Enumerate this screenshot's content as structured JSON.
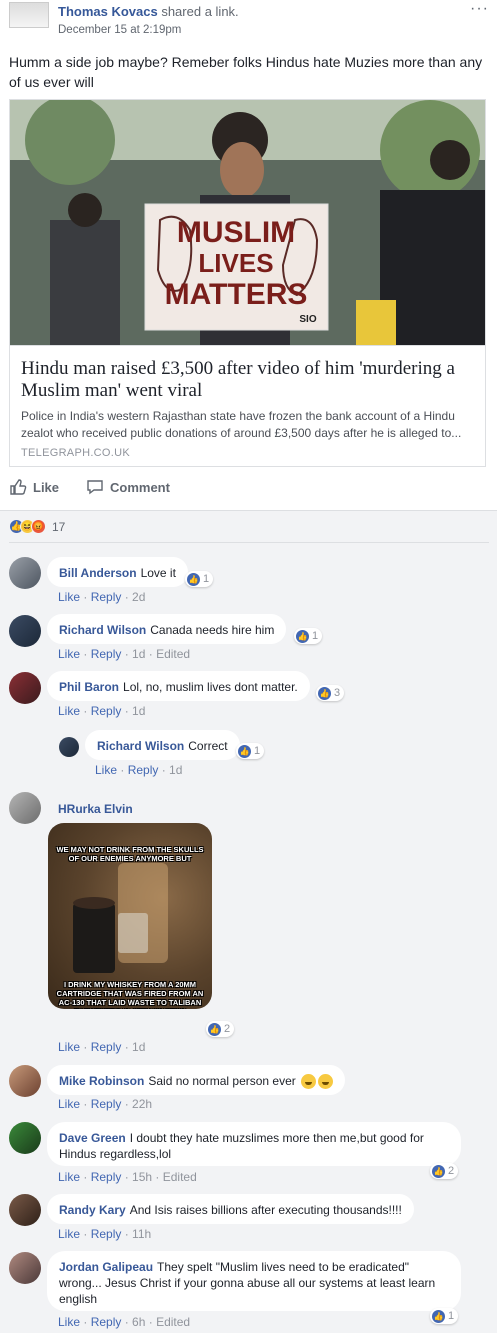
{
  "post": {
    "author": "Thomas Kovacs",
    "action": "shared a",
    "action_link": "link.",
    "timestamp": "December 15 at 2:19pm",
    "more_icon": "ellipsis-icon",
    "text": "Humm a side job maybe? Remeber folks Hindus hate Muzies more than any of us ever will",
    "link": {
      "image_sign_text": [
        "MUSLIM",
        "LIVES",
        "MATTERS",
        "SIO"
      ],
      "title": "Hindu man raised £3,500 after video of him 'murdering a Muslim man' went viral",
      "description": "Police in India's western Rajasthan state have frozen the bank account of a Hindu zealot who received public donations of around £3,500 days after he is alleged to...",
      "domain": "TELEGRAPH.CO.UK"
    },
    "actions": {
      "like": "Like",
      "comment": "Comment"
    },
    "reactions": {
      "count": "17",
      "types": [
        "like-icon",
        "haha-icon",
        "angry-icon"
      ]
    }
  },
  "comments": [
    {
      "name": "Bill Anderson",
      "text": "Love it",
      "like": "Like",
      "reply": "Reply",
      "time": "2d",
      "reacts": "1",
      "edited": ""
    },
    {
      "name": "Richard Wilson",
      "text": "Canada needs hire him",
      "like": "Like",
      "reply": "Reply",
      "time": "1d",
      "reacts": "1",
      "edited": "Edited"
    },
    {
      "name": "Phil Baron",
      "text": "Lol, no, muslim lives dont matter.",
      "like": "Like",
      "reply": "Reply",
      "time": "1d",
      "reacts": "3",
      "edited": ""
    },
    {
      "name": "Richard Wilson",
      "text": "Correct",
      "like": "Like",
      "reply": "Reply",
      "time": "1d",
      "reacts": "1",
      "edited": ""
    },
    {
      "name": "HRurka Elvin",
      "text": "",
      "like": "Like",
      "reply": "Reply",
      "time": "1d",
      "reacts": "2",
      "edited": "",
      "meme_top": "WE MAY NOT DRINK FROM THE SKULLS OF OUR ENEMIES ANYMORE BUT",
      "meme_bottom": "I DRINK MY WHISKEY FROM A 20MM CARTRIDGE THAT WAS FIRED FROM AN AC-130 THAT LAID WASTE TO TALIBAN FUCKTARDS IN AFGHANISTAN"
    },
    {
      "name": "Mike Robinson",
      "text": "Said no normal person ever",
      "like": "Like",
      "reply": "Reply",
      "time": "22h",
      "reacts": "",
      "edited": ""
    },
    {
      "name": "Dave Green",
      "text": "I doubt they hate muzslimes more then me,but good for Hindus regardless,lol",
      "like": "Like",
      "reply": "Reply",
      "time": "15h",
      "reacts": "2",
      "edited": "Edited"
    },
    {
      "name": "Randy Kary",
      "text": "And Isis raises billions after executing thousands!!!!",
      "like": "Like",
      "reply": "Reply",
      "time": "11h",
      "reacts": "",
      "edited": ""
    },
    {
      "name": "Jordan Galipeau",
      "text": "They spelt \"Muslim lives need to be eradicated\" wrong... Jesus Christ if your gonna abuse all our systems at least learn english",
      "like": "Like",
      "reply": "Reply",
      "time": "6h",
      "reacts": "1",
      "edited": "Edited"
    }
  ]
}
